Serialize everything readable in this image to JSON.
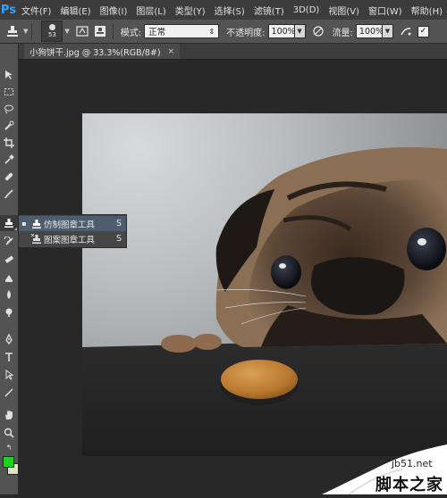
{
  "app": {
    "logo": "Ps"
  },
  "menu": {
    "items": [
      "文件(F)",
      "编辑(E)",
      "图像(I)",
      "图层(L)",
      "类型(Y)",
      "选择(S)",
      "滤镜(T)",
      "3D(D)",
      "视图(V)",
      "窗口(W)",
      "帮助(H)"
    ]
  },
  "options": {
    "brush_size": "53",
    "mode_label": "模式:",
    "mode_value": "正常",
    "opacity_label": "不透明度:",
    "opacity_value": "100%",
    "flow_label": "流量:",
    "flow_value": "100%"
  },
  "document": {
    "tab_title": "小狗饼干.jpg @ 33.3%(RGB/8#)",
    "close_glyph": "×"
  },
  "flyout": {
    "items": [
      {
        "label": "仿制图章工具",
        "shortcut": "S",
        "selected": true,
        "bullet": "▪"
      },
      {
        "label": "图案图章工具",
        "shortcut": "S",
        "selected": false,
        "bullet": ""
      }
    ]
  },
  "colors": {
    "foreground": "#1fd11f",
    "background": "#d9e6c4",
    "accent": "#2ba3ff"
  },
  "icons": {
    "toolbar": [
      "move-icon",
      "marquee-icon",
      "lasso-icon",
      "quick-select-icon",
      "crop-icon",
      "eyedropper-icon",
      "healing-brush-icon",
      "brush-icon",
      "clone-stamp-icon",
      "history-brush-icon",
      "eraser-icon",
      "gradient-icon",
      "blur-icon",
      "dodge-icon",
      "pen-icon",
      "type-icon",
      "path-select-icon",
      "line-icon",
      "hand-icon",
      "zoom-icon"
    ]
  },
  "watermark": {
    "url": "jb51.net",
    "text": "脚本之家"
  }
}
